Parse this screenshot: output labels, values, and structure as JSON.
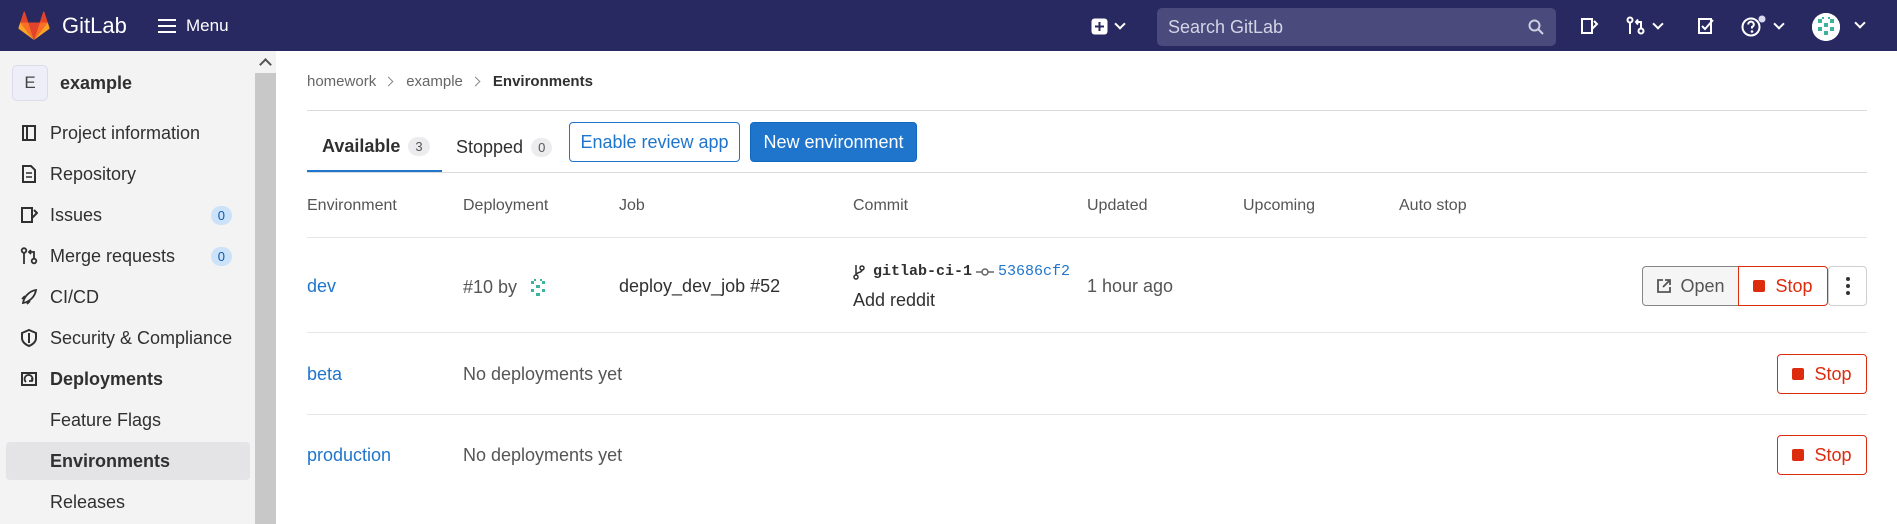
{
  "header": {
    "brand": "GitLab",
    "menu_label": "Menu",
    "search_placeholder": "Search GitLab",
    "icons": [
      "plus-square-icon",
      "todo-doc-icon",
      "merge-request-icon",
      "check-todo-icon",
      "help-icon",
      "user-avatar"
    ]
  },
  "sidebar": {
    "project_initial": "E",
    "project_name": "example",
    "items": [
      {
        "label": "Project information",
        "icon": "info-icon"
      },
      {
        "label": "Repository",
        "icon": "doc-icon"
      },
      {
        "label": "Issues",
        "icon": "issues-icon",
        "count": "0"
      },
      {
        "label": "Merge requests",
        "icon": "merge-request-icon",
        "count": "0"
      },
      {
        "label": "CI/CD",
        "icon": "rocket-icon"
      },
      {
        "label": "Security & Compliance",
        "icon": "shield-icon"
      },
      {
        "label": "Deployments",
        "icon": "deployments-icon"
      },
      {
        "label": "Feature Flags"
      },
      {
        "label": "Environments"
      },
      {
        "label": "Releases"
      }
    ]
  },
  "breadcrumb": {
    "items": [
      "homework",
      "example"
    ],
    "current": "Environments"
  },
  "tabs": {
    "available": {
      "label": "Available",
      "count": "3"
    },
    "stopped": {
      "label": "Stopped",
      "count": "0"
    }
  },
  "buttons": {
    "enable_review_app": "Enable review app",
    "new_environment": "New environment",
    "open": "Open",
    "stop": "Stop"
  },
  "table": {
    "columns": [
      "Environment",
      "Deployment",
      "Job",
      "Commit",
      "Updated",
      "Upcoming",
      "Auto stop"
    ],
    "rows": [
      {
        "environment": "dev",
        "deployment": "#10 by",
        "job": "deploy_dev_job #52",
        "branch": "gitlab-ci-1",
        "sha": "53686cf2",
        "commit_message": "Add reddit",
        "updated": "1 hour ago"
      },
      {
        "environment": "beta",
        "deployment": "No deployments yet"
      },
      {
        "environment": "production",
        "deployment": "No deployments yet"
      }
    ]
  },
  "colors": {
    "navbar": "#292961",
    "accent": "#1f75cb",
    "danger": "#dd2b0e"
  }
}
